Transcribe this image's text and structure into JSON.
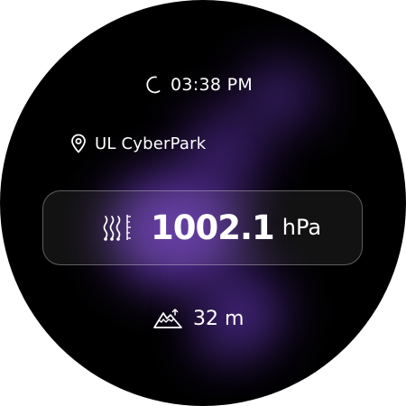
{
  "status": {
    "time": "03:38 PM",
    "time_icon": "crescent-moon-icon"
  },
  "location": {
    "name": "UL CyberPark",
    "icon": "location-pin-icon"
  },
  "pressure": {
    "value": "1002.1",
    "unit": "hPa",
    "icon": "barometer-icon"
  },
  "altitude": {
    "value": "32 m",
    "icon": "mountain-icon"
  },
  "theme": {
    "background": "#000000",
    "glow": "#7841d2",
    "text": "#ffffff"
  }
}
